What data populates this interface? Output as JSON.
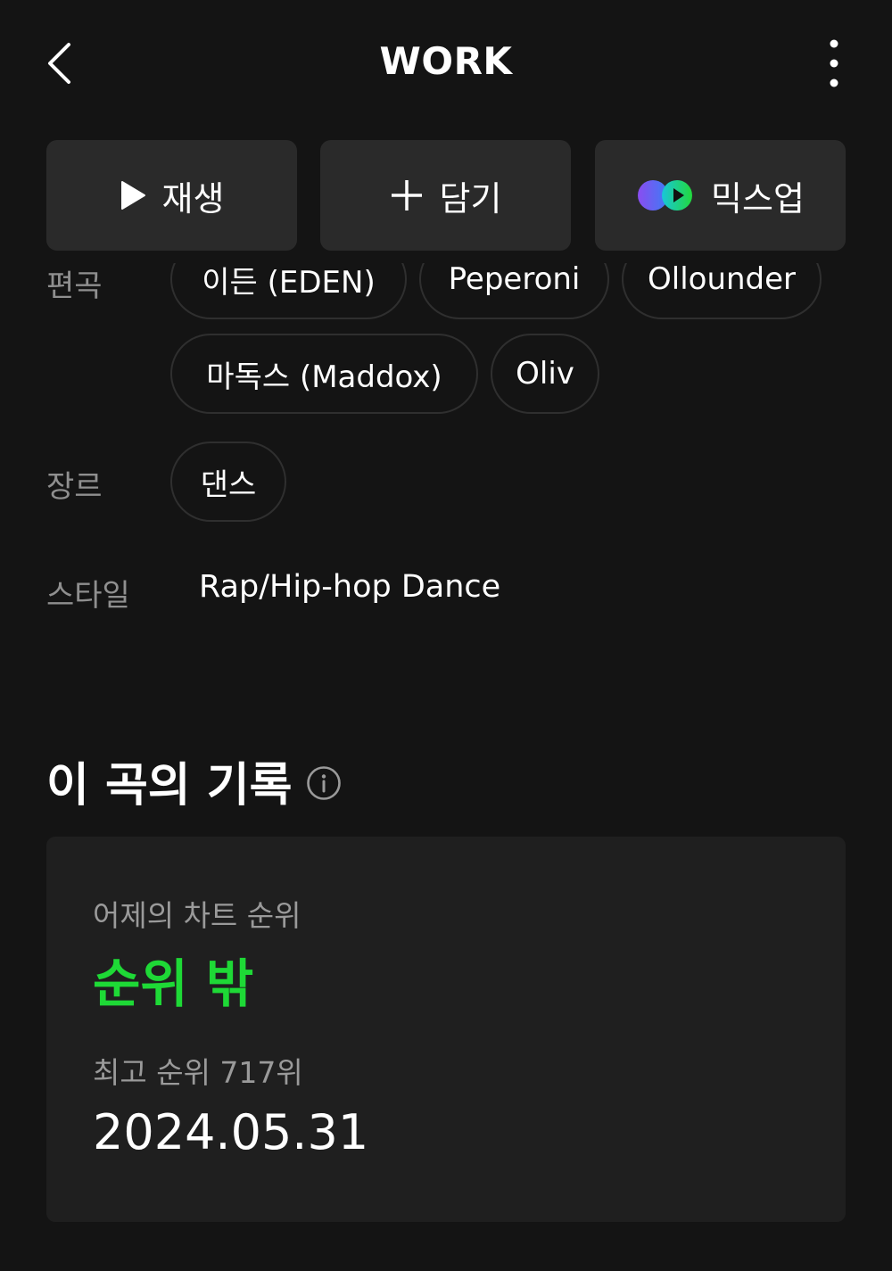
{
  "header": {
    "title": "WORK",
    "back_icon": "chevron-left-icon",
    "more_icon": "more-vertical-icon"
  },
  "actions": {
    "play_label": "재생",
    "add_label": "담기",
    "mixup_label": "믹스업"
  },
  "credits": {
    "arrangement_label": "편곡",
    "arrangers_row1": [
      "이든 (EDEN)",
      "Peperoni",
      "Ollounder"
    ],
    "arrangers_row2": [
      "마독스 (Maddox)",
      "Oliv"
    ],
    "genre_label": "장르",
    "genre": "댄스",
    "style_label": "스타일",
    "style": "Rap/Hip-hop Dance"
  },
  "record": {
    "section_title": "이 곡의 기록",
    "yesterday_label": "어제의 차트 순위",
    "yesterday_rank": "순위 밖",
    "best_rank_label": "최고 순위 717위",
    "best_rank_date": "2024.05.31"
  },
  "colors": {
    "background": "#141414",
    "accent_green": "#1ed936",
    "chip_border": "#2f2f2f",
    "card_bg": "#1f1f1f",
    "button_bg": "#2a2a2a"
  }
}
